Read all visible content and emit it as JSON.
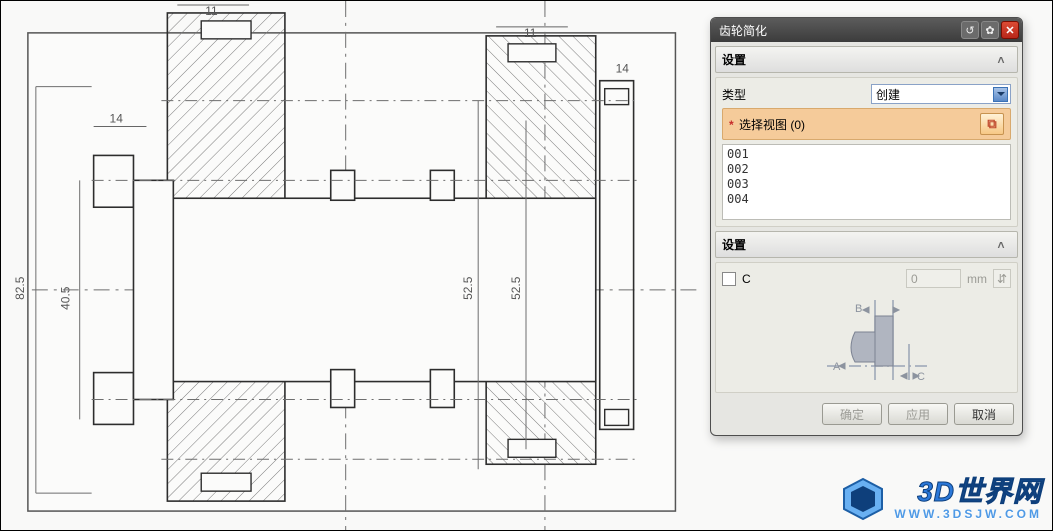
{
  "dialog": {
    "title": "齿轮简化",
    "sections": {
      "settings_label": "设置",
      "type_label": "类型",
      "type_value": "创建",
      "select_view_prefix": "选择视图",
      "select_view_count": "(0)",
      "list_items": [
        "001",
        "002",
        "003",
        "004"
      ],
      "inner_settings_label": "设置",
      "checkbox_label": "C",
      "num_value": "0",
      "num_unit": "mm",
      "schematic_labels": {
        "a": "A",
        "b": "B",
        "c": "C"
      }
    },
    "buttons": {
      "ok": "确定",
      "apply": "应用",
      "cancel": "取消"
    }
  },
  "drawing": {
    "dims": {
      "d1": "11",
      "d2": "11",
      "d3": "14",
      "d4": "14",
      "h1": "82.5",
      "h2": "40.5",
      "h3": "52.5",
      "h4": "52.5"
    }
  },
  "watermark": {
    "line1": "3D世界网",
    "line2": "WWW.3DSJW.COM"
  }
}
